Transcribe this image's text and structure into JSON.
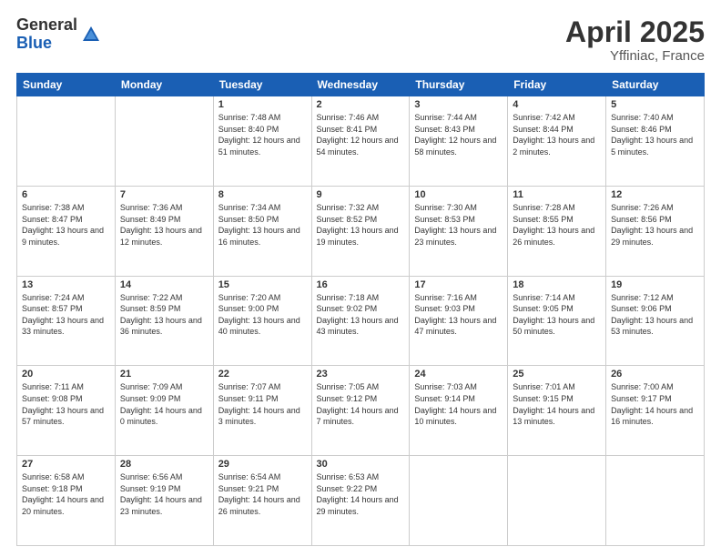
{
  "header": {
    "logo_general": "General",
    "logo_blue": "Blue",
    "title": "April 2025",
    "subtitle": "Yffiniac, France"
  },
  "columns": [
    "Sunday",
    "Monday",
    "Tuesday",
    "Wednesday",
    "Thursday",
    "Friday",
    "Saturday"
  ],
  "weeks": [
    [
      {
        "day": "",
        "info": ""
      },
      {
        "day": "",
        "info": ""
      },
      {
        "day": "1",
        "info": "Sunrise: 7:48 AM\nSunset: 8:40 PM\nDaylight: 12 hours and 51 minutes."
      },
      {
        "day": "2",
        "info": "Sunrise: 7:46 AM\nSunset: 8:41 PM\nDaylight: 12 hours and 54 minutes."
      },
      {
        "day": "3",
        "info": "Sunrise: 7:44 AM\nSunset: 8:43 PM\nDaylight: 12 hours and 58 minutes."
      },
      {
        "day": "4",
        "info": "Sunrise: 7:42 AM\nSunset: 8:44 PM\nDaylight: 13 hours and 2 minutes."
      },
      {
        "day": "5",
        "info": "Sunrise: 7:40 AM\nSunset: 8:46 PM\nDaylight: 13 hours and 5 minutes."
      }
    ],
    [
      {
        "day": "6",
        "info": "Sunrise: 7:38 AM\nSunset: 8:47 PM\nDaylight: 13 hours and 9 minutes."
      },
      {
        "day": "7",
        "info": "Sunrise: 7:36 AM\nSunset: 8:49 PM\nDaylight: 13 hours and 12 minutes."
      },
      {
        "day": "8",
        "info": "Sunrise: 7:34 AM\nSunset: 8:50 PM\nDaylight: 13 hours and 16 minutes."
      },
      {
        "day": "9",
        "info": "Sunrise: 7:32 AM\nSunset: 8:52 PM\nDaylight: 13 hours and 19 minutes."
      },
      {
        "day": "10",
        "info": "Sunrise: 7:30 AM\nSunset: 8:53 PM\nDaylight: 13 hours and 23 minutes."
      },
      {
        "day": "11",
        "info": "Sunrise: 7:28 AM\nSunset: 8:55 PM\nDaylight: 13 hours and 26 minutes."
      },
      {
        "day": "12",
        "info": "Sunrise: 7:26 AM\nSunset: 8:56 PM\nDaylight: 13 hours and 29 minutes."
      }
    ],
    [
      {
        "day": "13",
        "info": "Sunrise: 7:24 AM\nSunset: 8:57 PM\nDaylight: 13 hours and 33 minutes."
      },
      {
        "day": "14",
        "info": "Sunrise: 7:22 AM\nSunset: 8:59 PM\nDaylight: 13 hours and 36 minutes."
      },
      {
        "day": "15",
        "info": "Sunrise: 7:20 AM\nSunset: 9:00 PM\nDaylight: 13 hours and 40 minutes."
      },
      {
        "day": "16",
        "info": "Sunrise: 7:18 AM\nSunset: 9:02 PM\nDaylight: 13 hours and 43 minutes."
      },
      {
        "day": "17",
        "info": "Sunrise: 7:16 AM\nSunset: 9:03 PM\nDaylight: 13 hours and 47 minutes."
      },
      {
        "day": "18",
        "info": "Sunrise: 7:14 AM\nSunset: 9:05 PM\nDaylight: 13 hours and 50 minutes."
      },
      {
        "day": "19",
        "info": "Sunrise: 7:12 AM\nSunset: 9:06 PM\nDaylight: 13 hours and 53 minutes."
      }
    ],
    [
      {
        "day": "20",
        "info": "Sunrise: 7:11 AM\nSunset: 9:08 PM\nDaylight: 13 hours and 57 minutes."
      },
      {
        "day": "21",
        "info": "Sunrise: 7:09 AM\nSunset: 9:09 PM\nDaylight: 14 hours and 0 minutes."
      },
      {
        "day": "22",
        "info": "Sunrise: 7:07 AM\nSunset: 9:11 PM\nDaylight: 14 hours and 3 minutes."
      },
      {
        "day": "23",
        "info": "Sunrise: 7:05 AM\nSunset: 9:12 PM\nDaylight: 14 hours and 7 minutes."
      },
      {
        "day": "24",
        "info": "Sunrise: 7:03 AM\nSunset: 9:14 PM\nDaylight: 14 hours and 10 minutes."
      },
      {
        "day": "25",
        "info": "Sunrise: 7:01 AM\nSunset: 9:15 PM\nDaylight: 14 hours and 13 minutes."
      },
      {
        "day": "26",
        "info": "Sunrise: 7:00 AM\nSunset: 9:17 PM\nDaylight: 14 hours and 16 minutes."
      }
    ],
    [
      {
        "day": "27",
        "info": "Sunrise: 6:58 AM\nSunset: 9:18 PM\nDaylight: 14 hours and 20 minutes."
      },
      {
        "day": "28",
        "info": "Sunrise: 6:56 AM\nSunset: 9:19 PM\nDaylight: 14 hours and 23 minutes."
      },
      {
        "day": "29",
        "info": "Sunrise: 6:54 AM\nSunset: 9:21 PM\nDaylight: 14 hours and 26 minutes."
      },
      {
        "day": "30",
        "info": "Sunrise: 6:53 AM\nSunset: 9:22 PM\nDaylight: 14 hours and 29 minutes."
      },
      {
        "day": "",
        "info": ""
      },
      {
        "day": "",
        "info": ""
      },
      {
        "day": "",
        "info": ""
      }
    ]
  ]
}
